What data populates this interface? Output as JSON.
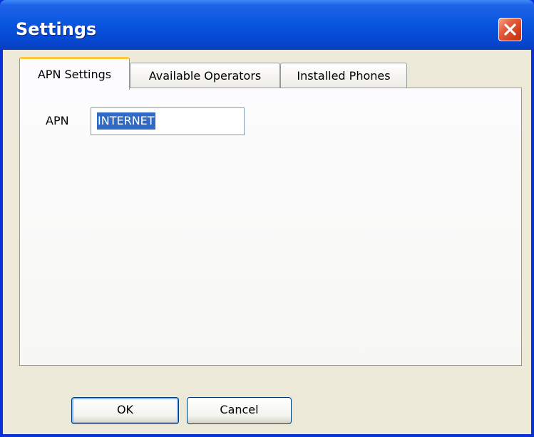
{
  "window": {
    "title": "Settings",
    "close_icon": "close-icon"
  },
  "tabs": [
    {
      "label": "APN Settings",
      "active": true
    },
    {
      "label": "Available Operators",
      "active": false
    },
    {
      "label": "Installed Phones",
      "active": false
    }
  ],
  "apn_settings": {
    "apn_label": "APN",
    "apn_value": "INTERNET"
  },
  "buttons": {
    "ok_label": "OK",
    "cancel_label": "Cancel"
  },
  "colors": {
    "titlebar": "#0a57e0",
    "close_button": "#d5401e",
    "active_tab_highlight": "#ffc83c",
    "selection": "#316ac5",
    "dialog_background": "#ece9d8"
  }
}
